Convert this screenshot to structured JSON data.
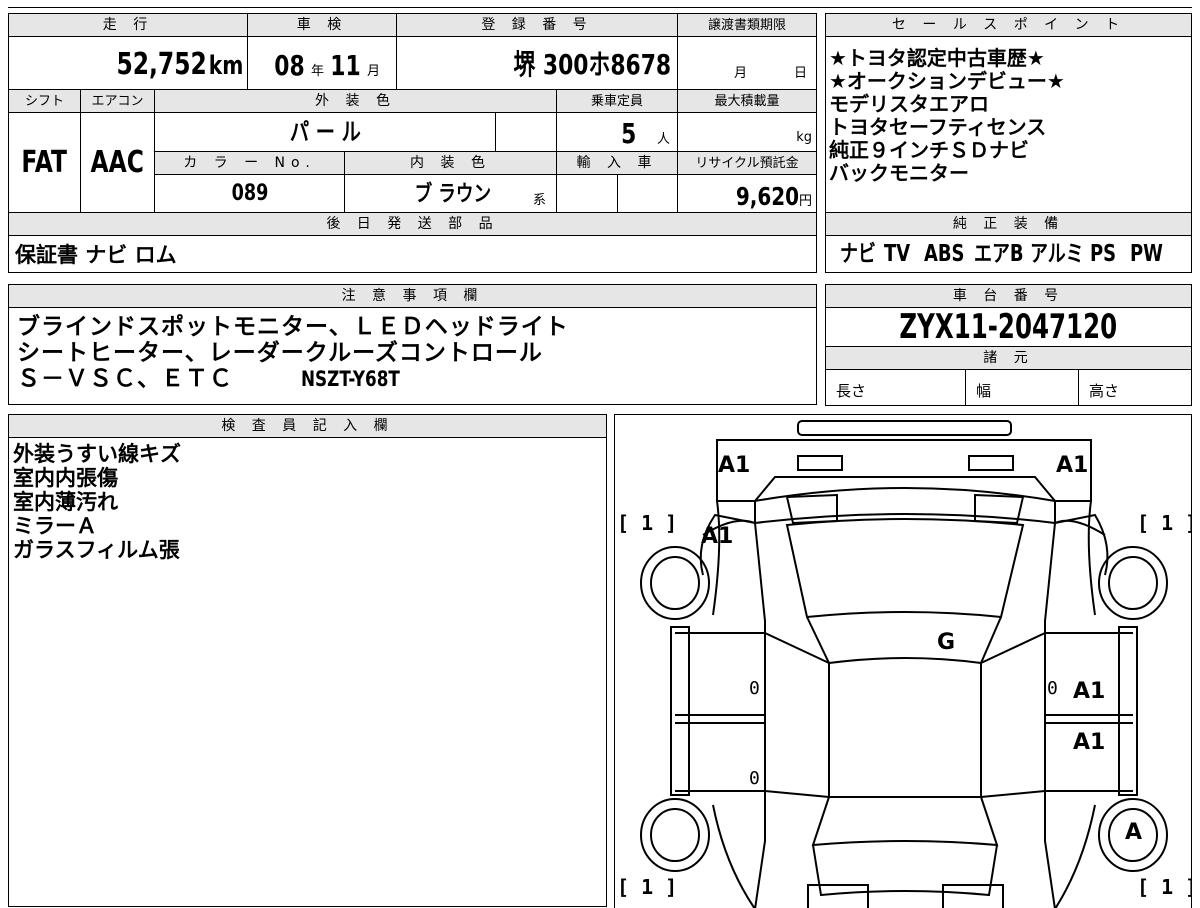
{
  "vehicle": {
    "mileage_header": "走 行",
    "mileage_value": "52,752",
    "mileage_unit": "km",
    "inspection_header": "車 検",
    "inspection_year": "08",
    "inspection_year_unit": "年",
    "inspection_month": "11",
    "inspection_month_unit": "月",
    "registration_header": "登 録 番 号",
    "registration_value": "堺 300ホ8678",
    "transfer_header": "譲渡書類期限",
    "transfer_month_unit": "月",
    "transfer_day_unit": "日",
    "shift_header": "シフト",
    "shift_value": "FAT",
    "ac_header": "エアコン",
    "ac_value": "AAC",
    "exterior_header": "外 装 色",
    "exterior_value": "パ ー ル",
    "capacity_header": "乗車定員",
    "capacity_value": "5",
    "capacity_unit": "人",
    "maxload_header": "最大積載量",
    "maxload_unit": "kg",
    "color_no_header": "カ ラ ー No.",
    "color_no_value": "089",
    "interior_header": "内 装 色",
    "interior_value": "ブ ラウン",
    "interior_suffix": "系",
    "import_header": "輸 入 車",
    "recycle_header": "リサイクル預託金",
    "recycle_value": "9,620",
    "recycle_unit": "円"
  },
  "later_parts": {
    "header": "後 日 発 送 部 品",
    "value": "保証書 ナビ ロム"
  },
  "sales_points": {
    "header": "セ ー ル ス ポ イ ン ト",
    "lines": [
      "★トヨタ認定中古車歴★",
      "★オークションデビュー★",
      "モデリスタエアロ",
      "トヨタセーフティセンス",
      "純正９インチＳＤナビ",
      "バックモニター"
    ]
  },
  "equipment": {
    "header": "純 正 装 備",
    "items": [
      "ナビ",
      "TV",
      "ABS",
      "エアB",
      "アルミ",
      "PS",
      "PW"
    ]
  },
  "notes": {
    "header": "注 意 事 項 欄",
    "lines": [
      "ブラインドスポットモニター、ＬＥＤヘッドライト",
      "シートヒーター、レーダークルーズコントロール",
      "Ｓ－ＶＳＣ、ＥＴＣ"
    ],
    "model_code": "NSZT-Y68T"
  },
  "chassis": {
    "header": "車 台 番 号",
    "value": "ZYX11-2047120"
  },
  "specs": {
    "header": "諸 元",
    "length_label": "長さ",
    "width_label": "幅",
    "height_label": "高さ"
  },
  "inspector": {
    "header": "検 査 員 記 入 欄",
    "lines": [
      "外装うすい線キズ",
      "室内内張傷",
      "室内薄汚れ",
      "ミラーＡ",
      "ガラスフィルム張"
    ]
  },
  "diagram": {
    "marks": {
      "front_left": "A1",
      "front_right": "A1",
      "left_fender": "A1",
      "windshield": "G",
      "right_front_door": "A1",
      "right_rear_door": "A1",
      "right_rear_wheel": "A",
      "left_front_door_zero": "0",
      "left_rear_door_zero": "0",
      "right_front_door_zero": "0"
    },
    "tire_marks": {
      "front_left": "[ 1 ]",
      "front_right": "[ 1 ]",
      "rear_left": "[ 1 ]",
      "rear_right": "[ 1 ]"
    }
  }
}
